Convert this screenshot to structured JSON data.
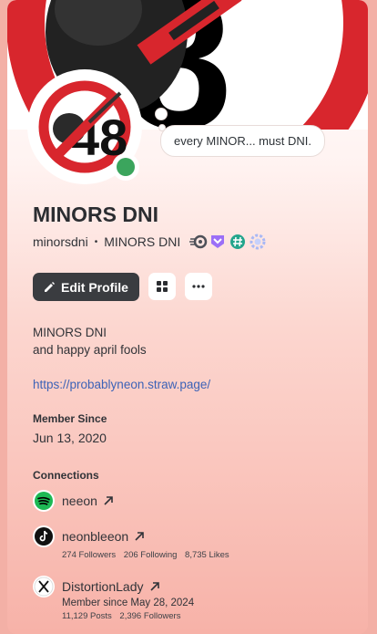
{
  "status": {
    "text": "every MINOR... must DNI."
  },
  "profile": {
    "display_name": "MINORS DNI",
    "username": "minorsdni",
    "separator": "•",
    "nickname": "MINORS DNI",
    "badges": [
      "hypesquad-badge",
      "nitro-badge",
      "hashtag-badge",
      "boost-badge"
    ]
  },
  "actions": {
    "edit_label": "Edit Profile"
  },
  "bio": {
    "line1": "MINORS DNI",
    "line2": "and happy april fools",
    "link": "https://probablyneon.straw.page/"
  },
  "member_since": {
    "title": "Member Since",
    "date": "Jun 13, 2020"
  },
  "connections": {
    "title": "Connections",
    "items": [
      {
        "service": "spotify",
        "name": "neeon",
        "meta": []
      },
      {
        "service": "tiktok",
        "name": "neonbleeon",
        "meta": [
          "274 Followers",
          "206 Following",
          "8,735 Likes"
        ]
      },
      {
        "service": "x",
        "name": "DistortionLady",
        "since": "Member since May 28, 2024",
        "meta": [
          "11,129 Posts",
          "2,396 Followers"
        ]
      }
    ]
  },
  "colors": {
    "status_online": "#3ba55d",
    "link": "#3d63b7",
    "button_dark": "#3a3c40",
    "nosign_red": "#d8262d"
  }
}
